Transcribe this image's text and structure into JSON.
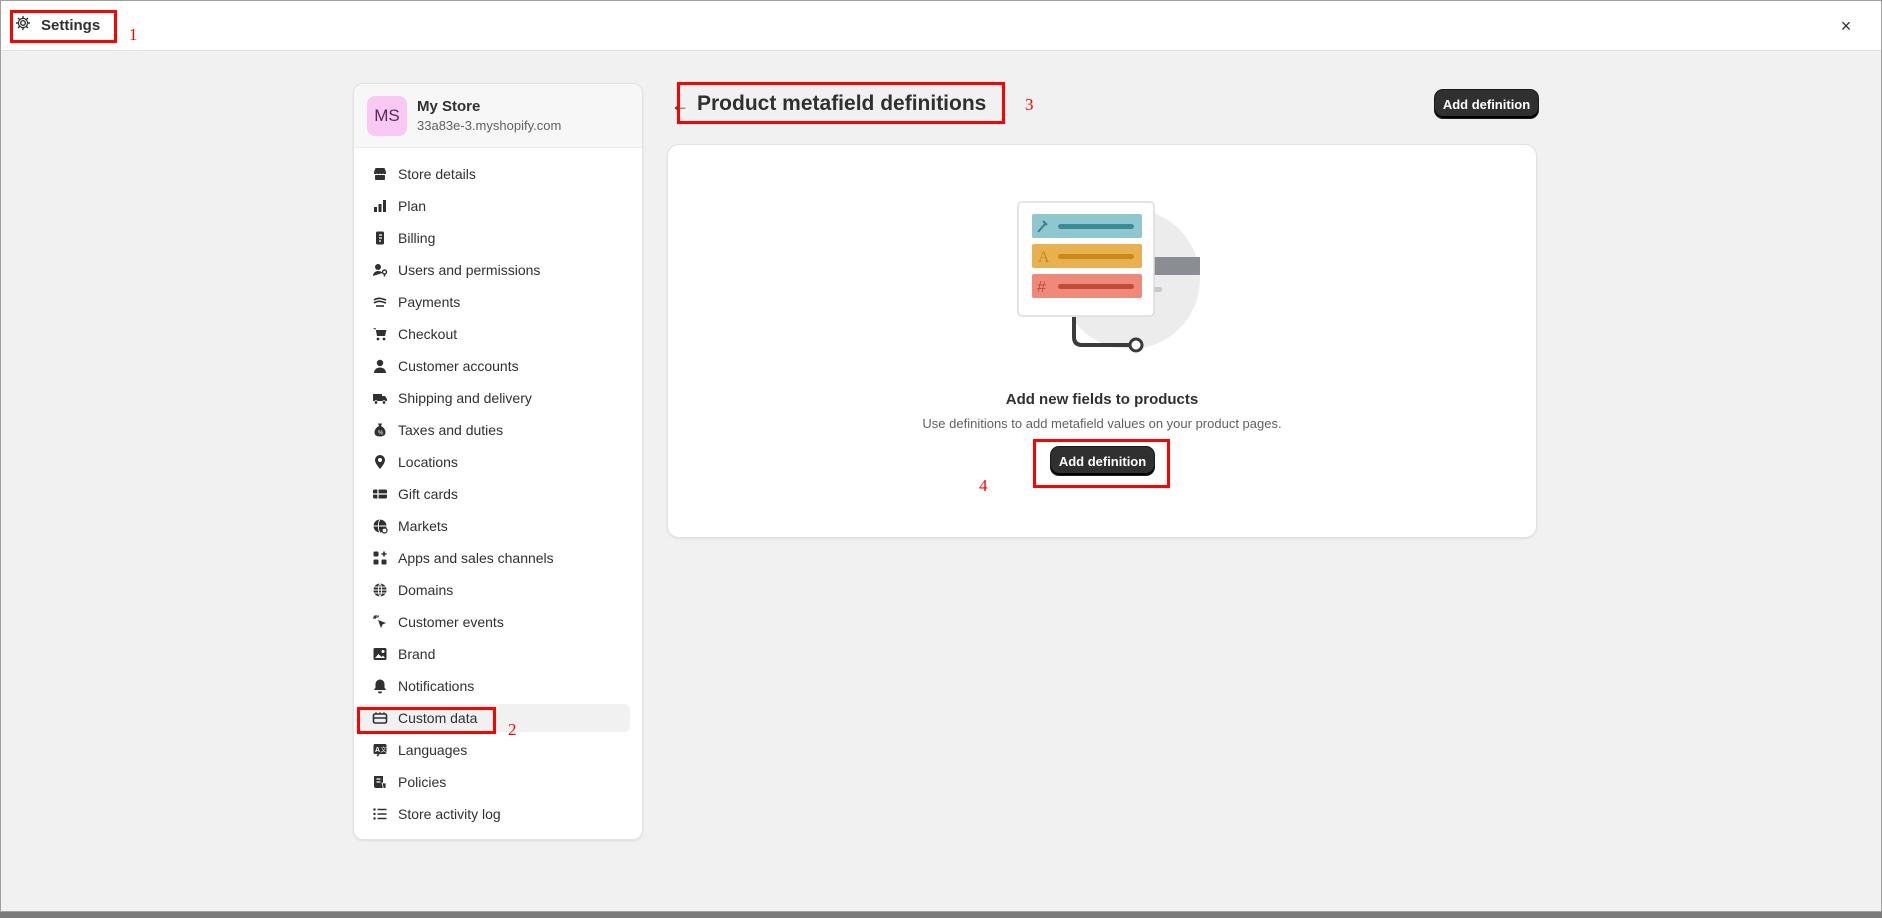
{
  "window": {
    "title": "Settings",
    "close_label": "×"
  },
  "annotations": [
    "1",
    "2",
    "3",
    "4"
  ],
  "store": {
    "initials": "MS",
    "name": "My Store",
    "domain": "33a83e-3.myshopify.com"
  },
  "sidebar": {
    "items": [
      {
        "label": "Store details",
        "icon": "store-icon"
      },
      {
        "label": "Plan",
        "icon": "plan-icon"
      },
      {
        "label": "Billing",
        "icon": "billing-icon"
      },
      {
        "label": "Users and permissions",
        "icon": "users-icon"
      },
      {
        "label": "Payments",
        "icon": "payments-icon"
      },
      {
        "label": "Checkout",
        "icon": "cart-icon"
      },
      {
        "label": "Customer accounts",
        "icon": "person-icon"
      },
      {
        "label": "Shipping and delivery",
        "icon": "truck-icon"
      },
      {
        "label": "Taxes and duties",
        "icon": "tax-icon"
      },
      {
        "label": "Locations",
        "icon": "location-pin-icon"
      },
      {
        "label": "Gift cards",
        "icon": "gift-card-icon"
      },
      {
        "label": "Markets",
        "icon": "globe-icon"
      },
      {
        "label": "Apps and sales channels",
        "icon": "apps-icon"
      },
      {
        "label": "Domains",
        "icon": "domain-globe-icon"
      },
      {
        "label": "Customer events",
        "icon": "cursor-click-icon"
      },
      {
        "label": "Brand",
        "icon": "brand-image-icon"
      },
      {
        "label": "Notifications",
        "icon": "bell-icon"
      },
      {
        "label": "Custom data",
        "icon": "custom-data-icon",
        "active": true
      },
      {
        "label": "Languages",
        "icon": "language-icon"
      },
      {
        "label": "Policies",
        "icon": "policy-icon"
      },
      {
        "label": "Store activity log",
        "icon": "list-icon"
      }
    ]
  },
  "page": {
    "back_label": "←",
    "title": "Product metafield definitions",
    "add_button_label": "Add definition"
  },
  "empty_state": {
    "heading": "Add new fields to products",
    "text": "Use definitions to add metafield values on your product pages.",
    "button_label": "Add definition"
  },
  "colors": {
    "accent_dark": "#303030",
    "annotation": "#ff0000",
    "avatar_bg": "#f9c8f5",
    "teal": "#8fc7cf",
    "amber": "#e8b04f",
    "coral": "#ef8a7a"
  }
}
